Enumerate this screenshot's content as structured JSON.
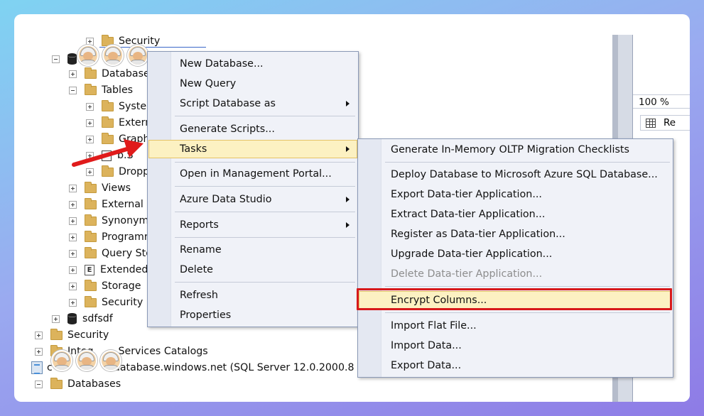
{
  "tree": {
    "items": [
      {
        "label": "Security",
        "icon": "folder"
      },
      {
        "label": "",
        "icon": "database"
      },
      {
        "label": "Database",
        "icon": "folder"
      },
      {
        "label": "Tables",
        "icon": "folder"
      },
      {
        "label": "Syster",
        "icon": "folder"
      },
      {
        "label": "Extern",
        "icon": "folder"
      },
      {
        "label": "Graph",
        "icon": "folder"
      },
      {
        "label": "b.S",
        "icon": "table"
      },
      {
        "label": "Dropp",
        "icon": "folder"
      },
      {
        "label": "Views",
        "icon": "folder"
      },
      {
        "label": "External R",
        "icon": "folder"
      },
      {
        "label": "Synonym",
        "icon": "folder"
      },
      {
        "label": "Programr",
        "icon": "folder"
      },
      {
        "label": "Query Sto",
        "icon": "folder"
      },
      {
        "label": "Extended",
        "icon": "extended-events"
      },
      {
        "label": "Storage",
        "icon": "folder"
      },
      {
        "label": "Security",
        "icon": "folder"
      },
      {
        "label": "sdfsdf",
        "icon": "database"
      },
      {
        "label": "Security",
        "icon": "folder"
      },
      {
        "label": "Services Catalogs",
        "prefix": "Integ",
        "icon": "folder"
      },
      {
        "label": "database.windows.net (SQL Server 12.0.2000.8 - s",
        "prefix": "c",
        "icon": "server"
      },
      {
        "label": "Databases",
        "icon": "folder"
      }
    ]
  },
  "context_menu": {
    "items": [
      {
        "label": "New Database..."
      },
      {
        "label": "New Query"
      },
      {
        "label": "Script Database as",
        "submenu": true
      },
      {
        "label": "Generate Scripts..."
      },
      {
        "label": "Tasks",
        "submenu": true,
        "hovered": true
      },
      {
        "label": "Open in Management Portal..."
      },
      {
        "label": "Azure Data Studio",
        "submenu": true
      },
      {
        "label": "Reports",
        "submenu": true
      },
      {
        "label": "Rename"
      },
      {
        "label": "Delete"
      },
      {
        "label": "Refresh"
      },
      {
        "label": "Properties"
      }
    ]
  },
  "tasks_submenu": {
    "items": [
      {
        "label": "Generate In-Memory OLTP Migration Checklists"
      },
      {
        "label": "Deploy Database to Microsoft Azure SQL Database..."
      },
      {
        "label": "Export Data-tier Application..."
      },
      {
        "label": "Extract Data-tier Application..."
      },
      {
        "label": "Register as Data-tier Application..."
      },
      {
        "label": "Upgrade Data-tier Application..."
      },
      {
        "label": "Delete Data-tier Application...",
        "disabled": true
      },
      {
        "label": "Encrypt Columns...",
        "highlighted": true
      },
      {
        "label": "Import Flat File..."
      },
      {
        "label": "Import Data..."
      },
      {
        "label": "Export Data..."
      }
    ]
  },
  "right_panel": {
    "zoom": "100 %",
    "results_tab": "Re"
  },
  "colors": {
    "highlight_border": "#d7191b",
    "hover_fill": "#fcf1c2",
    "arrow": "#e01b1b"
  }
}
